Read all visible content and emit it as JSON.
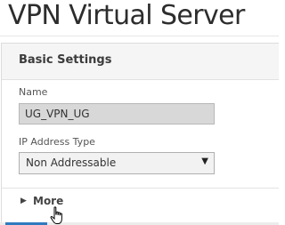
{
  "header": {
    "title": "VPN Virtual Server"
  },
  "panel": {
    "title": "Basic Settings",
    "fields": {
      "name": {
        "label": "Name",
        "value": "UG_VPN_UG"
      },
      "ip_address_type": {
        "label": "IP Address Type",
        "selected": "Non Addressable"
      }
    },
    "more_label": "More"
  },
  "icons": {
    "dropdown": "dropdown-arrow-icon",
    "expand": "expand-caret-icon",
    "cursor": "hand-pointer-cursor-icon"
  },
  "colors": {
    "input_background": "#d8d8d8",
    "panel_header_background": "#f5f5f5",
    "accent": "#2f7bbf"
  }
}
